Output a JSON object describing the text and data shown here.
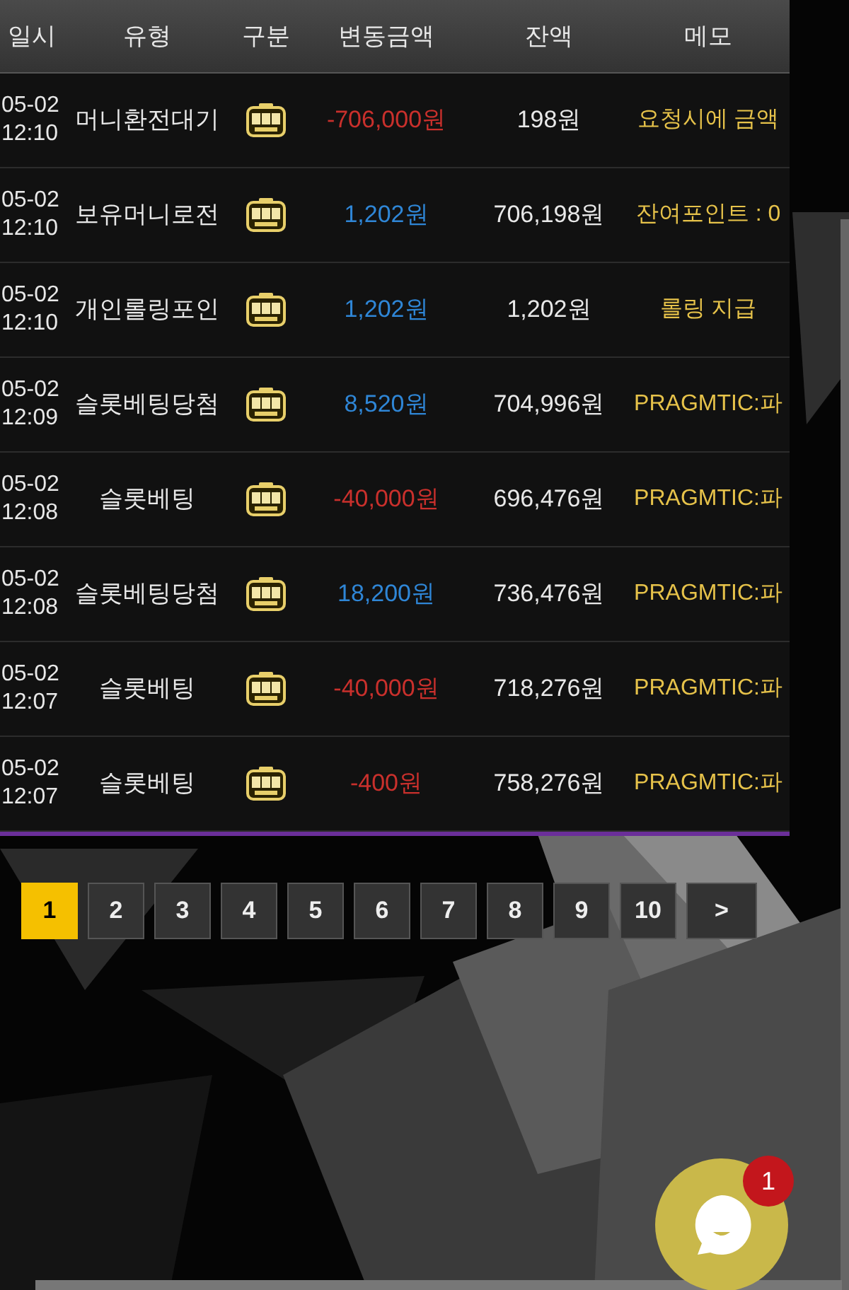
{
  "table": {
    "columns": [
      "일시",
      "유형",
      "구분",
      "변동금액",
      "잔액",
      "메모"
    ],
    "rows": [
      {
        "date": "05-02",
        "time": "12:10",
        "type": "머니환전대기",
        "amount": "-706,000원",
        "kind": "debit",
        "balance": "198원",
        "memo": "요청시에 금액"
      },
      {
        "date": "05-02",
        "time": "12:10",
        "type": "보유머니로전",
        "amount": "1,202원",
        "kind": "credit",
        "balance": "706,198원",
        "memo": "잔여포인트 : 0"
      },
      {
        "date": "05-02",
        "time": "12:10",
        "type": "개인롤링포인",
        "amount": "1,202원",
        "kind": "credit",
        "balance": "1,202원",
        "memo": "롤링 지급"
      },
      {
        "date": "05-02",
        "time": "12:09",
        "type": "슬롯베팅당첨",
        "amount": "8,520원",
        "kind": "credit",
        "balance": "704,996원",
        "memo": "PRAGMTIC:파"
      },
      {
        "date": "05-02",
        "time": "12:08",
        "type": "슬롯베팅",
        "amount": "-40,000원",
        "kind": "debit",
        "balance": "696,476원",
        "memo": "PRAGMTIC:파"
      },
      {
        "date": "05-02",
        "time": "12:08",
        "type": "슬롯베팅당첨",
        "amount": "18,200원",
        "kind": "credit",
        "balance": "736,476원",
        "memo": "PRAGMTIC:파"
      },
      {
        "date": "05-02",
        "time": "12:07",
        "type": "슬롯베팅",
        "amount": "-40,000원",
        "kind": "debit",
        "balance": "718,276원",
        "memo": "PRAGMTIC:파"
      },
      {
        "date": "05-02",
        "time": "12:07",
        "type": "슬롯베팅",
        "amount": "-400원",
        "kind": "debit",
        "balance": "758,276원",
        "memo": "PRAGMTIC:파"
      }
    ]
  },
  "pagination": [
    {
      "label": "1",
      "selected": true
    },
    {
      "label": "2",
      "selected": false
    },
    {
      "label": "3",
      "selected": false
    },
    {
      "label": "4",
      "selected": false
    },
    {
      "label": "5",
      "selected": false
    },
    {
      "label": "6",
      "selected": false
    },
    {
      "label": "7",
      "selected": false
    },
    {
      "label": "8",
      "selected": false
    },
    {
      "label": "9",
      "selected": false
    },
    {
      "label": "10",
      "selected": false
    },
    {
      "label": ">",
      "selected": false
    }
  ],
  "chat": {
    "badge": "1"
  }
}
